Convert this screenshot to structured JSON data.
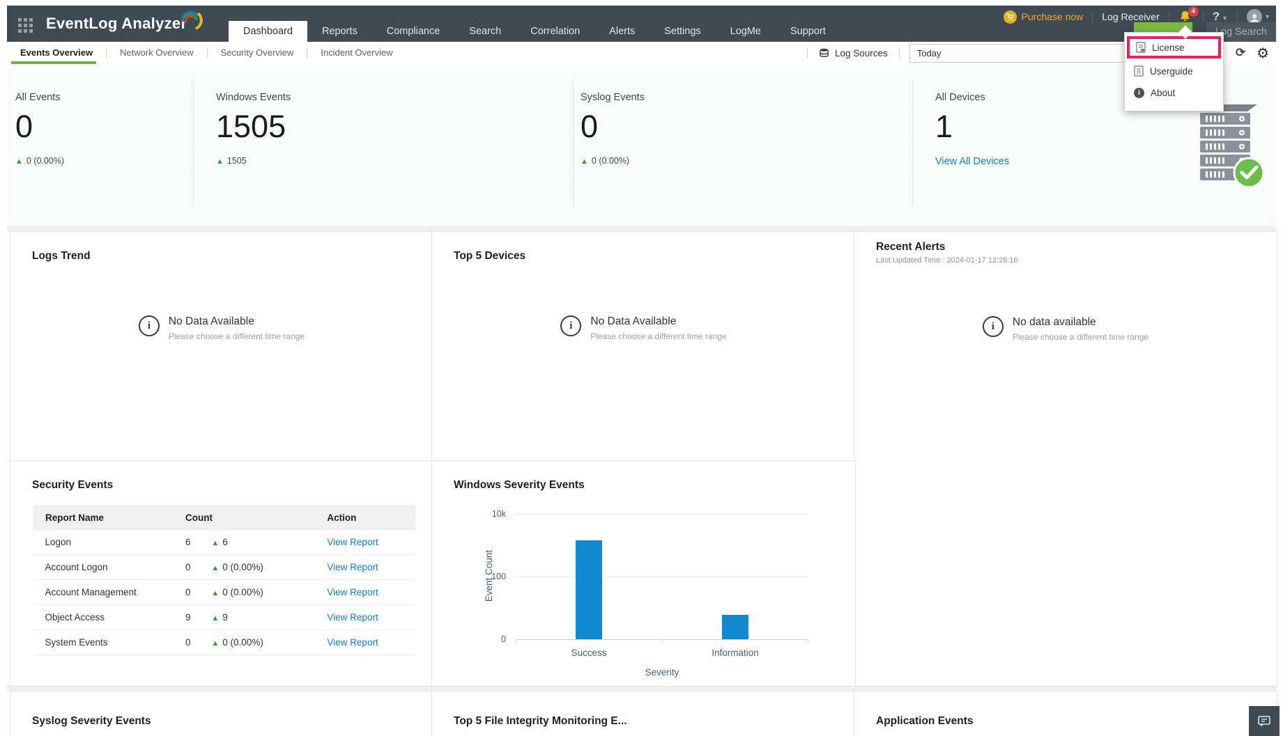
{
  "app": {
    "title": "EventLog Analyzer"
  },
  "topbar": {
    "purchase_now": "Purchase now",
    "log_receiver": "Log Receiver",
    "notification_count": "4",
    "help": "?",
    "log_search": "Log Search",
    "tabs": [
      {
        "label": "Dashboard",
        "active": true
      },
      {
        "label": "Reports"
      },
      {
        "label": "Compliance"
      },
      {
        "label": "Search"
      },
      {
        "label": "Correlation"
      },
      {
        "label": "Alerts"
      },
      {
        "label": "Settings"
      },
      {
        "label": "LogMe"
      },
      {
        "label": "Support"
      }
    ]
  },
  "help_menu": {
    "items": [
      {
        "label": "License",
        "highlighted": true
      },
      {
        "label": "Userguide"
      },
      {
        "label": "About"
      }
    ]
  },
  "subnav": {
    "tabs": [
      {
        "label": "Events Overview",
        "active": true
      },
      {
        "label": "Network Overview"
      },
      {
        "label": "Security Overview"
      },
      {
        "label": "Incident Overview"
      }
    ],
    "log_sources": "Log Sources",
    "time_range": "Today"
  },
  "stats": {
    "all_events": {
      "label": "All Events",
      "value": "0",
      "delta": "0 (0.00%)"
    },
    "windows_events": {
      "label": "Windows Events",
      "value": "1505",
      "delta": "1505"
    },
    "syslog_events": {
      "label": "Syslog Events",
      "value": "0",
      "delta": "0 (0.00%)"
    },
    "all_devices": {
      "label": "All Devices",
      "value": "1",
      "link": "View All Devices"
    }
  },
  "panels": {
    "logs_trend": {
      "title": "Logs Trend",
      "empty_title": "No Data Available",
      "empty_sub": "Please choose a different time range"
    },
    "top_devices": {
      "title": "Top 5 Devices",
      "empty_title": "No Data Available",
      "empty_sub": "Please choose a different time range"
    },
    "recent_alerts": {
      "title": "Recent Alerts",
      "updated": "Last Updated Time : 2024-01-17 12:28:16",
      "empty_title": "No data available",
      "empty_sub": "Please choose a different time range"
    },
    "security_events": {
      "title": "Security Events",
      "columns": [
        "Report Name",
        "Count",
        "Action"
      ],
      "rows": [
        {
          "name": "Logon",
          "count": "6",
          "delta": "6",
          "action": "View Report"
        },
        {
          "name": "Account Logon",
          "count": "0",
          "delta": "0 (0.00%)",
          "action": "View Report"
        },
        {
          "name": "Account Management",
          "count": "0",
          "delta": "0 (0.00%)",
          "action": "View Report"
        },
        {
          "name": "Object Access",
          "count": "9",
          "delta": "9",
          "action": "View Report"
        },
        {
          "name": "System Events",
          "count": "0",
          "delta": "0 (0.00%)",
          "action": "View Report"
        }
      ]
    },
    "syslog_severity": {
      "title": "Syslog Severity Events"
    },
    "fim": {
      "title": "Top 5 File Integrity Monitoring E..."
    },
    "application_events": {
      "title": "Application Events"
    }
  },
  "chart_data": {
    "type": "bar",
    "title": "Windows Severity Events",
    "categories": [
      "Success",
      "Information"
    ],
    "values": [
      1466,
      39
    ],
    "xlabel": "Severity",
    "ylabel": "Event Count",
    "yticks": [
      "0",
      "100",
      "10k"
    ],
    "scale": "log",
    "ylim": [
      0,
      10000
    ],
    "grid": true,
    "legend": false,
    "bar_color": "#1289cf"
  },
  "colors": {
    "topbar": "#3f4a52",
    "accent_green": "#6db33f",
    "link_blue": "#1a7bbf",
    "bar_blue": "#1289cf",
    "highlight_pink": "#ee2060",
    "purchase_orange": "#f0a63c",
    "badge_red": "#e23e3e",
    "check_green": "#6abf4b"
  }
}
